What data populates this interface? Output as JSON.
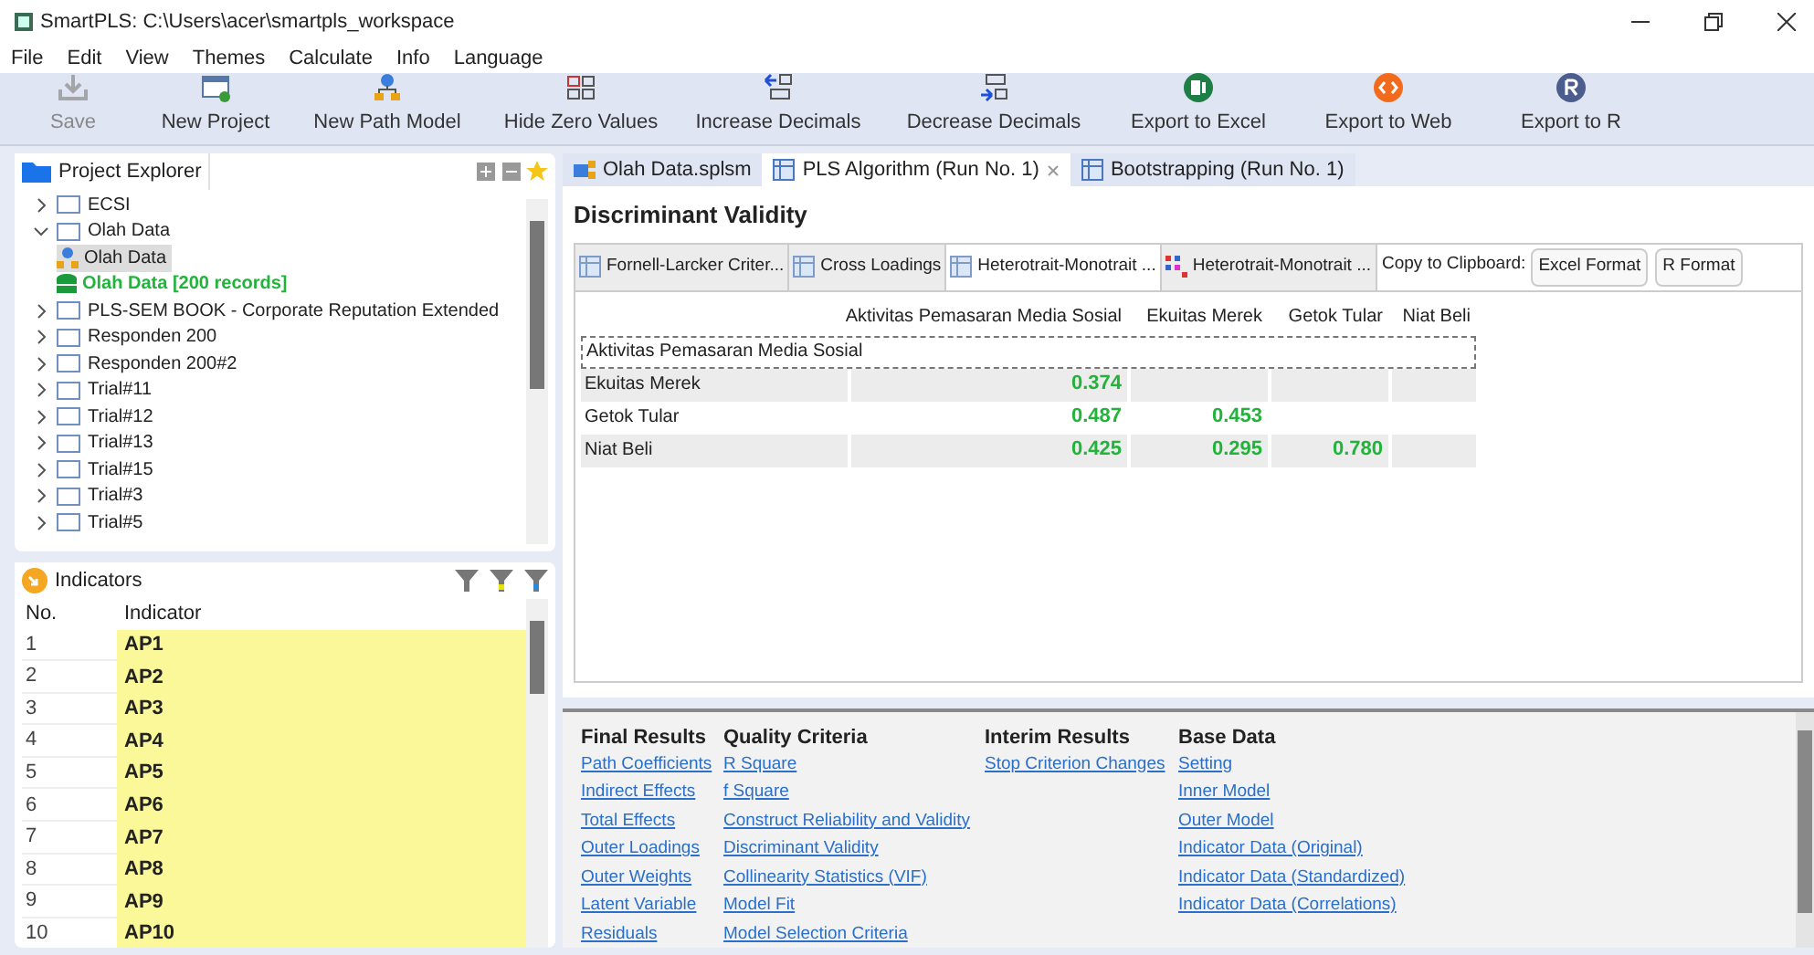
{
  "window": {
    "title": "SmartPLS: C:\\Users\\acer\\smartpls_workspace"
  },
  "menu": [
    "File",
    "Edit",
    "View",
    "Themes",
    "Calculate",
    "Info",
    "Language"
  ],
  "toolbar": [
    {
      "label": "Save",
      "kind": "save",
      "disabled": true
    },
    {
      "label": "New Project",
      "kind": "project",
      "disabled": false
    },
    {
      "label": "New Path Model",
      "kind": "model",
      "disabled": false
    },
    {
      "label": "Hide Zero Values",
      "kind": "zero",
      "disabled": false
    },
    {
      "label": "Increase Decimals",
      "kind": "inc",
      "disabled": false
    },
    {
      "label": "Decrease Decimals",
      "kind": "dec",
      "disabled": false
    },
    {
      "label": "Export to Excel",
      "kind": "excel",
      "disabled": false
    },
    {
      "label": "Export to Web",
      "kind": "web",
      "disabled": false
    },
    {
      "label": "Export to R",
      "kind": "r",
      "disabled": false
    }
  ],
  "project_explorer": {
    "title": "Project Explorer",
    "items": [
      {
        "label": "ECSI",
        "expanded": false,
        "selected": false
      },
      {
        "label": "Olah Data",
        "expanded": true,
        "selected": false,
        "children": [
          {
            "label": "Olah Data",
            "kind": "model",
            "selected": true
          },
          {
            "label": "Olah Data [200 records]",
            "kind": "data",
            "selected": false
          }
        ]
      },
      {
        "label": "PLS-SEM BOOK - Corporate Reputation Extended",
        "expanded": false,
        "selected": false
      },
      {
        "label": "Responden 200",
        "expanded": false,
        "selected": false
      },
      {
        "label": "Responden 200#2",
        "expanded": false,
        "selected": false
      },
      {
        "label": "Trial#11",
        "expanded": false,
        "selected": false
      },
      {
        "label": "Trial#12",
        "expanded": false,
        "selected": false
      },
      {
        "label": "Trial#13",
        "expanded": false,
        "selected": false
      },
      {
        "label": "Trial#15",
        "expanded": false,
        "selected": false
      },
      {
        "label": "Trial#3",
        "expanded": false,
        "selected": false
      },
      {
        "label": "Trial#5",
        "expanded": false,
        "selected": false
      }
    ]
  },
  "indicators": {
    "title": "Indicators",
    "columns": [
      "No.",
      "Indicator"
    ],
    "rows": [
      [
        "1",
        "AP1"
      ],
      [
        "2",
        "AP2"
      ],
      [
        "3",
        "AP3"
      ],
      [
        "4",
        "AP4"
      ],
      [
        "5",
        "AP5"
      ],
      [
        "6",
        "AP6"
      ],
      [
        "7",
        "AP7"
      ],
      [
        "8",
        "AP8"
      ],
      [
        "9",
        "AP9"
      ],
      [
        "10",
        "AP10"
      ]
    ]
  },
  "editor_tabs": [
    {
      "label": "Olah Data.splsm",
      "kind": "model",
      "selected": false
    },
    {
      "label": "PLS Algorithm (Run No. 1)",
      "kind": "table",
      "selected": true
    },
    {
      "label": "Bootstrapping (Run No. 1)",
      "kind": "table",
      "selected": false
    }
  ],
  "report": {
    "title": "Discriminant Validity",
    "sub_tabs": [
      {
        "label": "Fornell-Larcker Criter...",
        "kind": "table",
        "selected": false
      },
      {
        "label": "Cross Loadings",
        "kind": "table",
        "selected": false
      },
      {
        "label": "Heterotrait-Monotrait ...",
        "kind": "table",
        "selected": true
      },
      {
        "label": "Heterotrait-Monotrait ...",
        "kind": "chart",
        "selected": false
      }
    ],
    "copy_label": "Copy to Clipboard:",
    "copy_buttons": [
      "Excel Format",
      "R Format"
    ],
    "columns": [
      "Aktivitas Pemasaran Media Sosial",
      "Ekuitas Merek",
      "Getok Tular",
      "Niat Beli"
    ],
    "rows": [
      {
        "label": "Aktivitas Pemasaran Media Sosial",
        "focused": true
      },
      {
        "label": "Ekuitas Merek",
        "focused": false,
        "values": [
          "0.374"
        ]
      },
      {
        "label": "Getok Tular",
        "focused": false,
        "values": [
          "0.487",
          "0.453"
        ]
      },
      {
        "label": "Niat Beli",
        "focused": false,
        "values": [
          "0.425",
          "0.295",
          "0.780"
        ]
      }
    ]
  },
  "links": [
    {
      "heading": "Final Results",
      "items": [
        "Path Coefficients",
        "Indirect Effects",
        "Total Effects",
        "Outer Loadings",
        "Outer Weights",
        "Latent Variable",
        "Residuals"
      ]
    },
    {
      "heading": "Quality Criteria",
      "items": [
        "R Square",
        "f Square",
        "Construct Reliability and Validity",
        "Discriminant Validity",
        "Collinearity Statistics (VIF)",
        "Model Fit",
        "Model Selection Criteria"
      ]
    },
    {
      "heading": "Interim Results",
      "items": [
        "Stop Criterion Changes"
      ]
    },
    {
      "heading": "Base Data",
      "items": [
        "Setting",
        "Inner Model",
        "Outer Model",
        "Indicator Data (Original)",
        "Indicator Data (Standardized)",
        "Indicator Data (Correlations)"
      ]
    }
  ]
}
